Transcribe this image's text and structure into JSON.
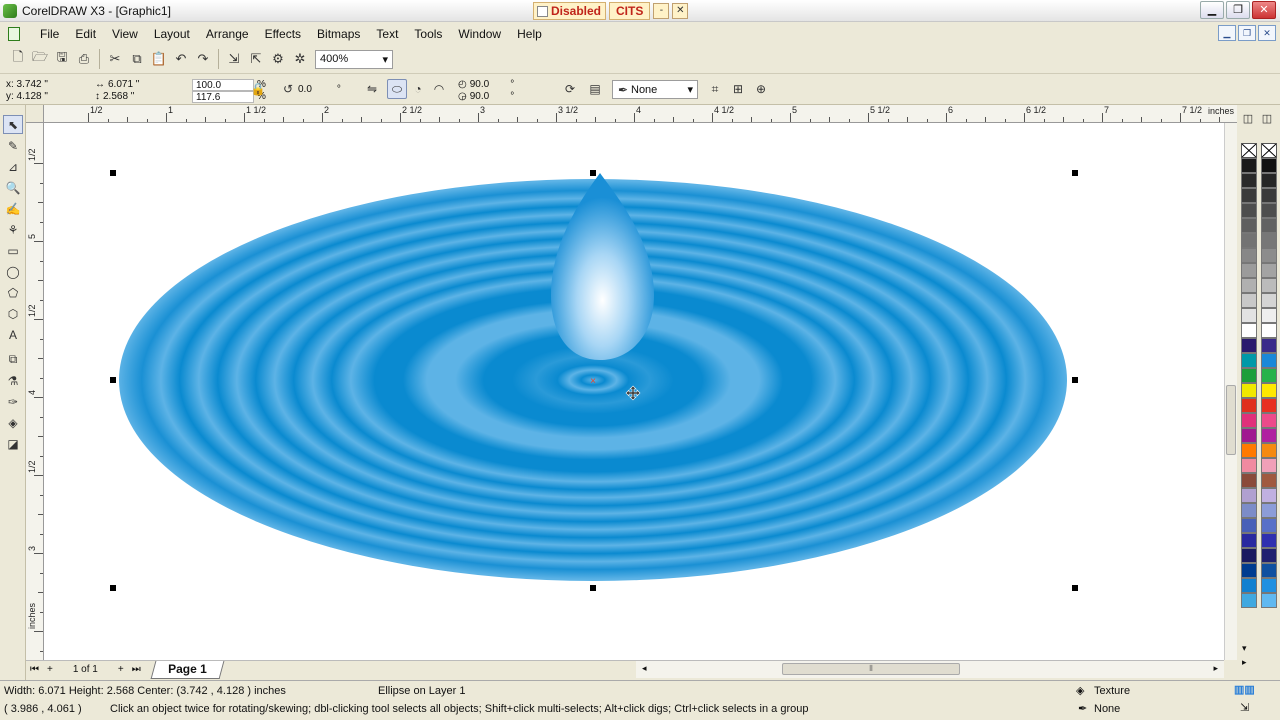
{
  "window": {
    "title": "CorelDRAW X3 - [Graphic1]",
    "ext_disabled": "Disabled",
    "ext_cits": "CITS"
  },
  "menu": [
    "File",
    "Edit",
    "View",
    "Layout",
    "Arrange",
    "Effects",
    "Bitmaps",
    "Text",
    "Tools",
    "Window",
    "Help"
  ],
  "toolbar": {
    "zoom": "400%"
  },
  "propbar": {
    "x": "x: 3.742 \"",
    "y": "y: 4.128 \"",
    "w": "6.071 \"",
    "h": "2.568 \"",
    "scale_x": "100.0",
    "scale_y": "117.6",
    "rotation": "0.0",
    "start_angle": "90.0",
    "end_angle": "90.0",
    "outline": "None",
    "pct1": "%",
    "pct2": "%",
    "deg": "°",
    "deg2": "°",
    "deg3": "°"
  },
  "ruler": {
    "units": "inches",
    "top_labels": [
      "1/2",
      "1",
      "1 1/2",
      "2",
      "2 1/2",
      "3",
      "3 1/2",
      "4",
      "4 1/2",
      "5",
      "5 1/2",
      "6",
      "6 1/2",
      "7",
      "7 1/2"
    ],
    "left_labels": [
      "1/2",
      "5",
      "1/2",
      "4",
      "1/2",
      "3",
      "inches"
    ]
  },
  "pages": {
    "counter": "1 of 1",
    "tab": "Page 1"
  },
  "status": {
    "dims": "Width: 6.071  Height: 2.568  Center: (3.742 , 4.128 )  inches",
    "object": "Ellipse on Layer 1",
    "fill": "Texture",
    "outline": "None",
    "cursor": "( 3.986 , 4.061 )",
    "hint": "Click an object twice for rotating/skewing; dbl-clicking tool selects all objects; Shift+click multi-selects; Alt+click digs; Ctrl+click selects in a group"
  },
  "colors": {
    "ring_dark": "#0a8ad0",
    "ring_light": "#5db3e6",
    "drop_top": "#1a8fd6",
    "drop_center": "#ffffff"
  },
  "palette_left": [
    "#1a1a1a",
    "#2a2a2a",
    "#3b3b3b",
    "#4d4d4d",
    "#5f5f5f",
    "#737373",
    "#878787",
    "#9b9b9b",
    "#b0b0b0",
    "#c8c8c8",
    "#e2e2e2",
    "#ffffff",
    "#2a1a6e",
    "#0099a8",
    "#1d9e3a",
    "#f0e800",
    "#e0301e",
    "#e0307a",
    "#a01890",
    "#ff7a00",
    "#f08aa0",
    "#8a4a3a",
    "#b0a0d0",
    "#7c8cc8",
    "#4860b8",
    "#2a2aa0",
    "#1a1a60",
    "#003c90",
    "#1080d0",
    "#40a8e0"
  ],
  "palette_right": [
    "#111111",
    "#262626",
    "#3a3a3a",
    "#4e4e4e",
    "#626262",
    "#777777",
    "#8c8c8c",
    "#a3a3a3",
    "#bbbbbb",
    "#d4d4d4",
    "#eeeeee",
    "#ffffff",
    "#3a2a8a",
    "#1a88d8",
    "#27b24a",
    "#ffe800",
    "#e83020",
    "#ec4a8a",
    "#b020a0",
    "#f58a10",
    "#f0a0b8",
    "#a05a40",
    "#c0b0e0",
    "#8c9cd8",
    "#5870c8",
    "#3030b0",
    "#202070",
    "#1050a0",
    "#2090e0",
    "#60b8f0"
  ]
}
